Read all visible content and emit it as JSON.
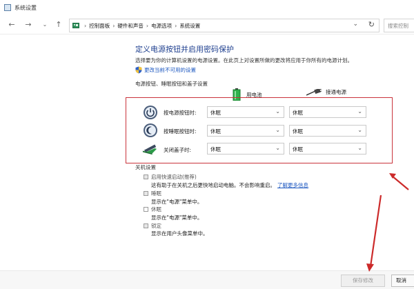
{
  "window": {
    "title": "系统设置"
  },
  "breadcrumbs": [
    "控制面板",
    "硬件和声音",
    "电源选项",
    "系统设置"
  ],
  "search": {
    "placeholder": "搜索控制"
  },
  "main": {
    "title": "定义电源按钮并启用密码保护",
    "description": "选择要为你的计算机设置的电源设置。在此页上对设置所做的更改将应用于你所有的电源计划。",
    "change_link": "更改当前不可用的设置",
    "buttons_section": {
      "title": "电源按钮、睡眠按钮和盖子设置",
      "columns": [
        "用电池",
        "接通电源"
      ],
      "rows": [
        {
          "label": "按电源按钮时:",
          "battery": "休眠",
          "plugged": "休眠"
        },
        {
          "label": "按睡眠按钮时:",
          "battery": "休眠",
          "plugged": "休眠"
        },
        {
          "label": "关闭盖子时:",
          "battery": "休眠",
          "plugged": "休眠"
        }
      ]
    },
    "shutdown_section": {
      "title": "关机设置",
      "options": [
        {
          "label": "启用快速启动(推荐)",
          "desc": "这有助于在关机之后更快地启动电脑。不会影响重启。",
          "link": "了解更多信息"
        },
        {
          "label": "睡眠",
          "desc": "显示在\"电源\"菜单中。"
        },
        {
          "label": "休眠",
          "desc": "显示在\"电源\"菜单中。"
        },
        {
          "label": "锁定",
          "desc": "显示在用户头像菜单中。"
        }
      ]
    }
  },
  "footer": {
    "save_label": "保存修改",
    "cancel_label": "取消"
  },
  "colors": {
    "accent": "#1e3f8f",
    "link": "#1e58c0",
    "highlight": "#c9323a"
  }
}
